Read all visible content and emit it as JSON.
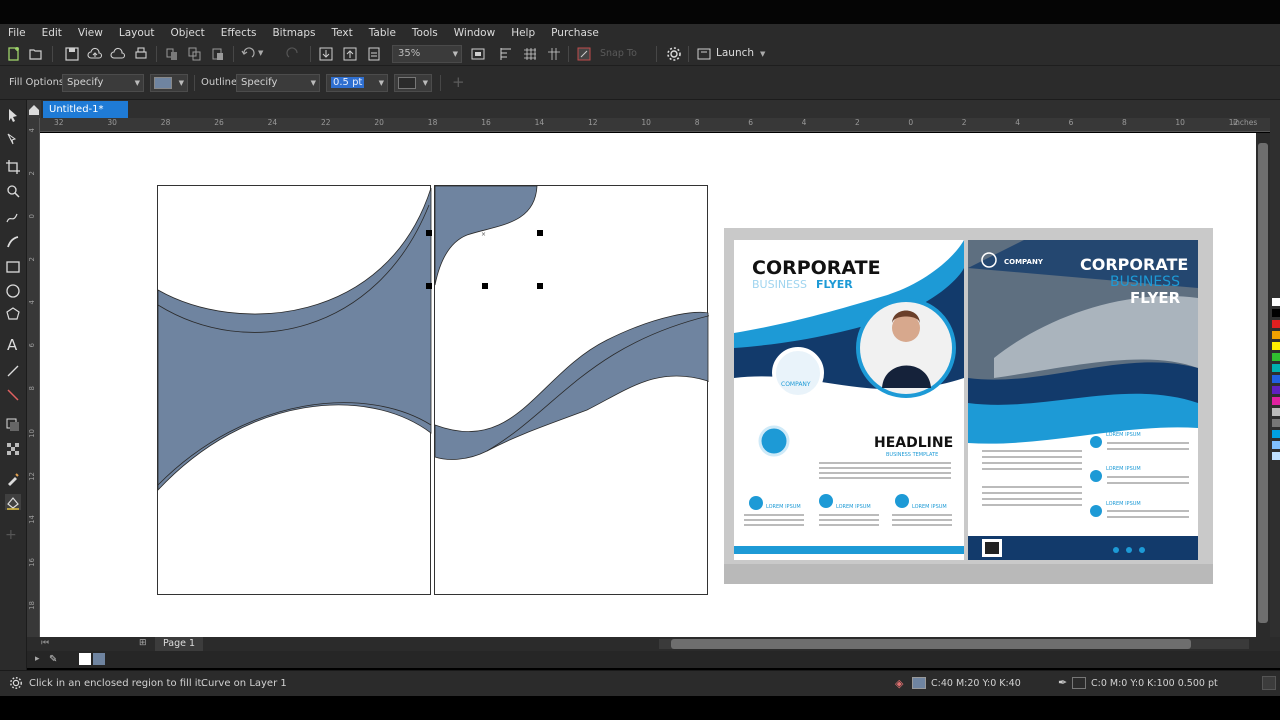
{
  "menu": [
    "File",
    "Edit",
    "View",
    "Layout",
    "Object",
    "Effects",
    "Bitmaps",
    "Text",
    "Table",
    "Tools",
    "Window",
    "Help",
    "Purchase"
  ],
  "standard_toolbar": {
    "zoom": "35%",
    "snap_to": "Snap To",
    "launch": "Launch"
  },
  "property_bar": {
    "fill_options_label": "Fill Options:",
    "fill_options_value": "Specify",
    "outline_label": "Outline:",
    "outline_value": "Specify",
    "outline_width": "0.5 pt"
  },
  "document_tab": "Untitled-1*",
  "ruler": {
    "unit": "inches",
    "h_ticks": [
      "32",
      "30",
      "28",
      "26",
      "24",
      "22",
      "20",
      "18",
      "16",
      "14",
      "12",
      "10",
      "8",
      "6",
      "4",
      "2",
      "0",
      "2",
      "4",
      "6",
      "8",
      "10",
      "12"
    ],
    "v_ticks": [
      "4",
      "2",
      "0",
      "2",
      "4",
      "6",
      "8",
      "10",
      "12",
      "14",
      "16",
      "18"
    ]
  },
  "page_tab": "Page 1",
  "status": {
    "hint": "Click in an enclosed region to fill it.",
    "object": "Curve on Layer 1",
    "fill_color": "C:40 M:20 Y:0 K:40",
    "outline_color": "C:0 M:0 Y:0 K:100  0.500 pt"
  },
  "colors": {
    "fill": "#6f84a0",
    "accent": "#1f7bd6",
    "flyer_blue": "#1d9ad6",
    "flyer_navy": "#123a6b"
  },
  "flyer": {
    "left_title": "CORPORATE",
    "left_sub1": "BUSINESS",
    "left_sub2": "FLYER",
    "company": "COMPANY",
    "headline": "HEADLINE",
    "headline_sub": "BUSINESS TEMPLATE",
    "lorem": "LOREM IPSUM",
    "right_company": "COMPANY",
    "right_title1": "CORPORATE",
    "right_title2": "BUSINESS",
    "right_title3": "FLYER"
  }
}
